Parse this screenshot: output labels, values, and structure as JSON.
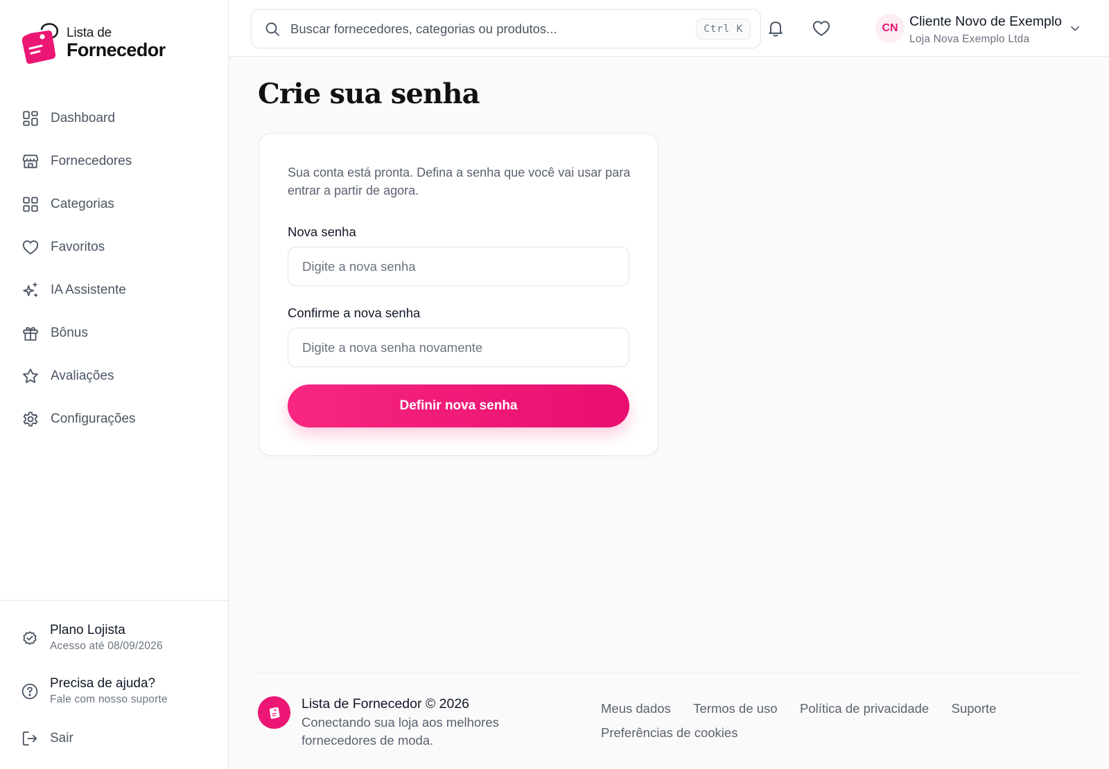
{
  "brand": {
    "name_line1": "Lista de",
    "name_line2": "Fornecedor",
    "accent_color": "#ec1674"
  },
  "sidebar": {
    "items": [
      {
        "label": "Dashboard",
        "icon": "dashboard-icon"
      },
      {
        "label": "Fornecedores",
        "icon": "store-icon"
      },
      {
        "label": "Categorias",
        "icon": "grid-icon"
      },
      {
        "label": "Favoritos",
        "icon": "heart-icon"
      },
      {
        "label": "IA Assistente",
        "icon": "sparkles-icon"
      },
      {
        "label": "Bônus",
        "icon": "gift-icon"
      },
      {
        "label": "Avaliações",
        "icon": "star-icon"
      },
      {
        "label": "Configurações",
        "icon": "gear-icon"
      }
    ],
    "plan": {
      "title": "Plano Lojista",
      "subtitle": "Acesso até 08/09/2026",
      "icon": "badge-check-icon"
    },
    "help": {
      "title": "Precisa de ajuda?",
      "subtitle": "Fale com nosso suporte",
      "icon": "help-circle-icon"
    },
    "logout": {
      "label": "Sair",
      "icon": "logout-icon"
    }
  },
  "header": {
    "search_placeholder": "Buscar fornecedores, categorias ou produtos...",
    "shortcut": "Ctrl K",
    "user": {
      "initials": "CN",
      "name": "Cliente Novo de Exemplo",
      "store": "Loja Nova Exemplo Ltda"
    }
  },
  "main": {
    "title": "Crie sua senha",
    "description": "Sua conta está pronta. Defina a senha que você vai usar para entrar a partir de agora.",
    "new_password": {
      "label": "Nova senha",
      "placeholder": "Digite a nova senha"
    },
    "confirm_password": {
      "label": "Confirme a nova senha",
      "placeholder": "Digite a nova senha novamente"
    },
    "submit_label": "Definir nova senha"
  },
  "footer": {
    "title": "Lista de Fornecedor © 2026",
    "description": "Conectando sua loja aos melhores fornecedores de moda.",
    "links": [
      "Meus dados",
      "Termos de uso",
      "Política de privacidade",
      "Suporte",
      "Preferências de cookies"
    ]
  }
}
